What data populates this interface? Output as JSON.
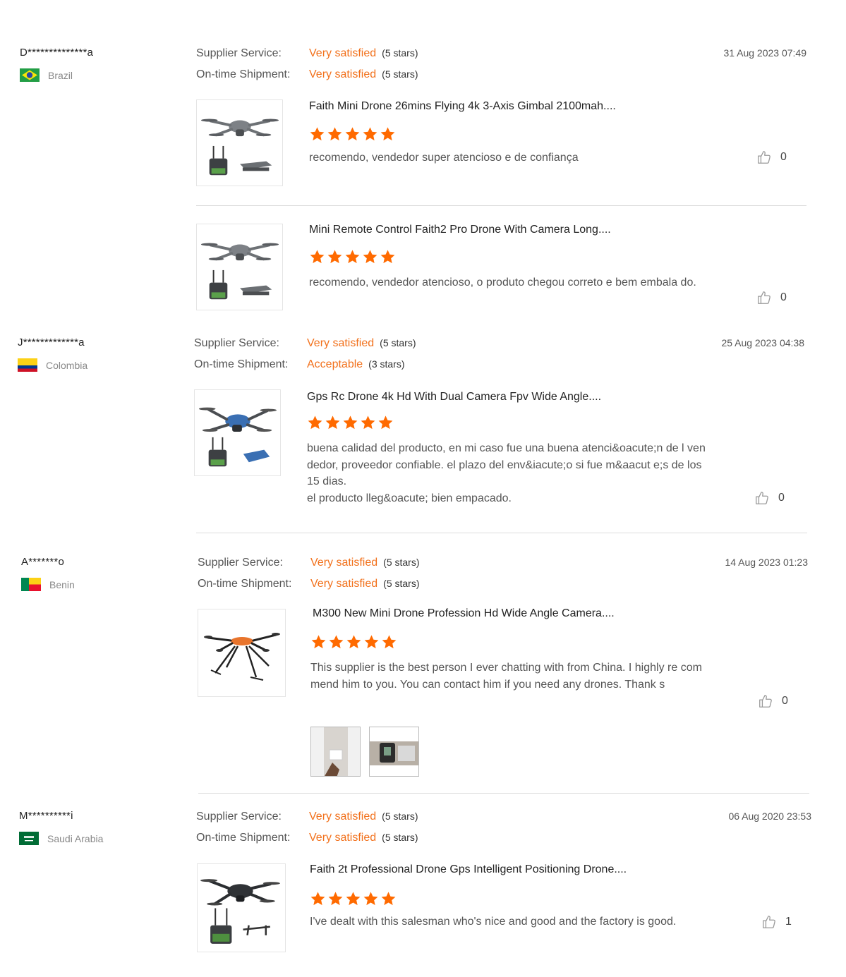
{
  "labels": {
    "supplier_service": "Supplier Service:",
    "ontime_shipment": "On-time Shipment:"
  },
  "colors": {
    "accent": "#f2711c",
    "star": "#ff6a00"
  },
  "reviews": [
    {
      "buyer": "D**************a",
      "country": "Brazil",
      "flag_icon": "brazil-flag-icon",
      "date": "31 Aug 2023 07:49",
      "supplier_rating": "Very satisfied",
      "supplier_stars": "(5 stars)",
      "shipment_rating": "Very satisfied",
      "shipment_stars": "(5 stars)",
      "items": [
        {
          "title": "Faith Mini Drone 26mins Flying 4k 3-Axis Gimbal 2100mah....",
          "rating": 5,
          "comment": "recomendo, vendedor super atencioso e de confiança",
          "likes": "0"
        },
        {
          "title": "Mini Remote Control Faith2 Pro Drone With Camera Long....",
          "rating": 5,
          "comment": "recomendo, vendedor atencioso, o produto chegou correto e bem embala do.",
          "likes": "0"
        }
      ]
    },
    {
      "buyer": "J*************a",
      "country": "Colombia",
      "flag_icon": "colombia-flag-icon",
      "date": "25 Aug 2023 04:38",
      "supplier_rating": "Very satisfied",
      "supplier_stars": "(5 stars)",
      "shipment_rating": "Acceptable",
      "shipment_stars": "(3 stars)",
      "items": [
        {
          "title": "Gps Rc Drone 4k Hd With Dual Camera Fpv Wide Angle....",
          "rating": 5,
          "comment": "buena calidad del producto, en mi caso fue una buena atenci&oacute;n de l vendedor, proveedor confiable. el plazo del env&iacute;o si fue m&aacut e;s de los 15 dias.",
          "comment2": "el producto lleg&oacute; bien empacado.",
          "likes": "0"
        }
      ]
    },
    {
      "buyer": "A*******o",
      "country": "Benin",
      "flag_icon": "benin-flag-icon",
      "date": "14 Aug 2023 01:23",
      "supplier_rating": "Very satisfied",
      "supplier_stars": "(5 stars)",
      "shipment_rating": "Very satisfied",
      "shipment_stars": "(5 stars)",
      "items": [
        {
          "title": "M300 New Mini Drone Profession Hd Wide Angle Camera....",
          "rating": 5,
          "comment": "This supplier is the best person I ever chatting with from China. I highly re commend him to you. You can contact him if you need any drones. Thank s",
          "likes": "0"
        }
      ]
    },
    {
      "buyer": "M**********i",
      "country": "Saudi Arabia",
      "flag_icon": "saudi-arabia-flag-icon",
      "date": "06 Aug 2020 23:53",
      "supplier_rating": "Very satisfied",
      "supplier_stars": "(5 stars)",
      "shipment_rating": "Very satisfied",
      "shipment_stars": "(5 stars)",
      "items": [
        {
          "title": "Faith 2t Professional Drone Gps Intelligent Positioning Drone....",
          "rating": 5,
          "comment": "I've dealt with this salesman who's nice and good and the factory is good.",
          "likes": "1"
        }
      ]
    }
  ]
}
